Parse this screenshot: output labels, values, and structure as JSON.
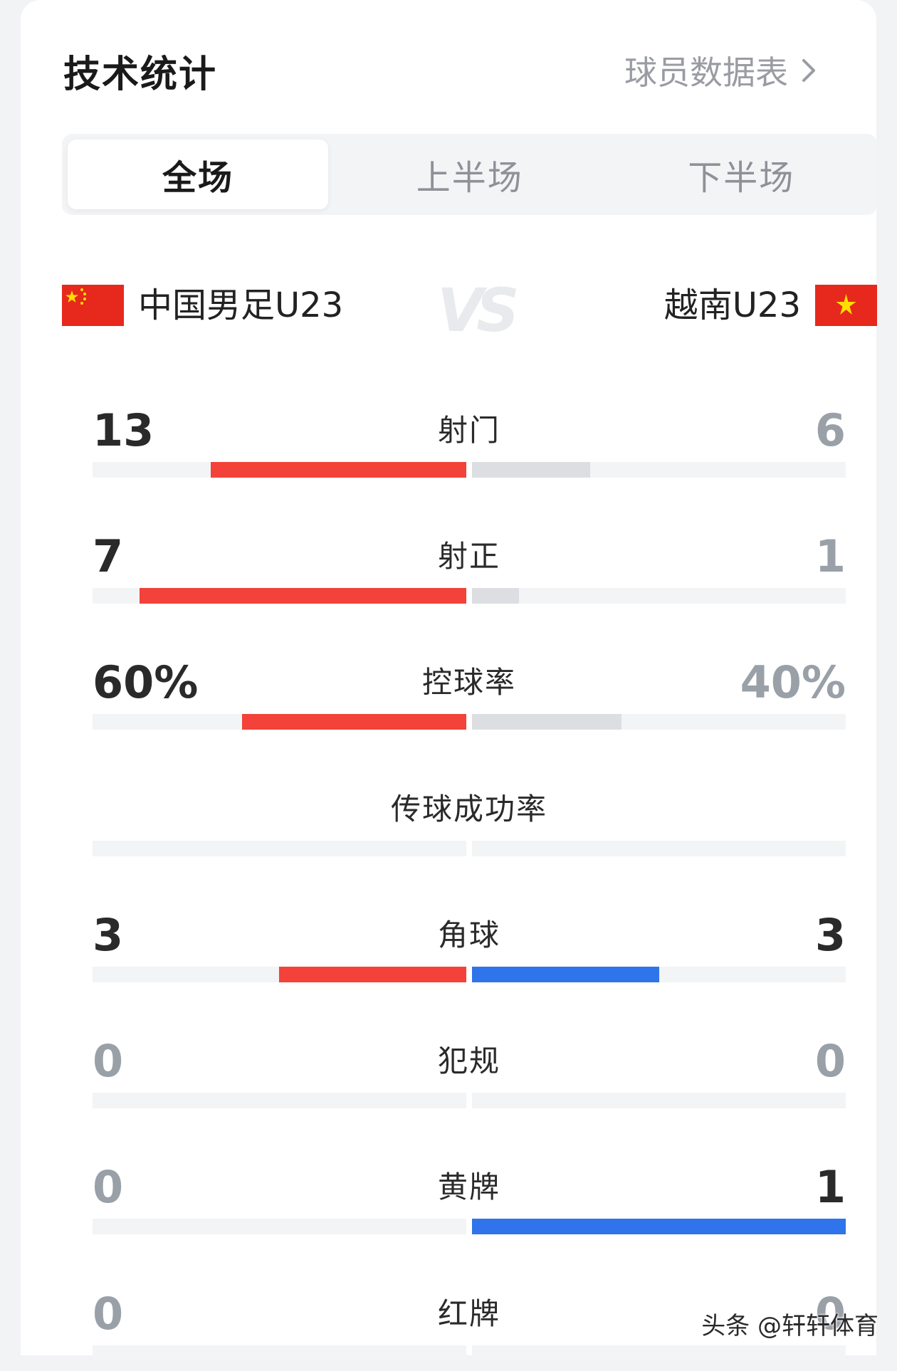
{
  "header": {
    "title": "技术统计",
    "player_link": "球员数据表"
  },
  "tabs": [
    {
      "label": "全场",
      "active": true
    },
    {
      "label": "上半场",
      "active": false
    },
    {
      "label": "下半场",
      "active": false
    }
  ],
  "match": {
    "home": {
      "name": "中国男足U23",
      "flag": "china-flag-icon"
    },
    "away": {
      "name": "越南U23",
      "flag": "vietnam-flag-icon"
    },
    "vs": "VS"
  },
  "stats": [
    {
      "label": "射门",
      "home": "13",
      "away": "6",
      "home_share": 0.684,
      "away_share": 0.316,
      "home_color": "red",
      "away_color": "grey"
    },
    {
      "label": "射正",
      "home": "7",
      "away": "1",
      "home_share": 0.875,
      "away_share": 0.125,
      "home_color": "red",
      "away_color": "grey"
    },
    {
      "label": "控球率",
      "home": "60%",
      "away": "40%",
      "home_share": 0.6,
      "away_share": 0.4,
      "home_color": "red",
      "away_color": "grey"
    },
    {
      "label": "传球成功率",
      "home": "",
      "away": "",
      "home_share": 0,
      "away_share": 0,
      "home_color": "red",
      "away_color": "grey"
    },
    {
      "label": "角球",
      "home": "3",
      "away": "3",
      "home_share": 0.5,
      "away_share": 0.5,
      "home_color": "red",
      "away_color": "blue"
    },
    {
      "label": "犯规",
      "home": "0",
      "away": "0",
      "home_share": 0,
      "away_share": 0,
      "home_color": "red",
      "away_color": "blue"
    },
    {
      "label": "黄牌",
      "home": "0",
      "away": "1",
      "home_share": 0,
      "away_share": 1,
      "home_color": "red",
      "away_color": "blue"
    },
    {
      "label": "红牌",
      "home": "0",
      "away": "0",
      "home_share": 0,
      "away_share": 0,
      "home_color": "red",
      "away_color": "blue"
    }
  ],
  "colors": {
    "home_bar": "#f2423a",
    "away_bar_grey": "#dcdee2",
    "away_bar_blue": "#2f74ea",
    "track": "#f3f4f6"
  },
  "watermark": "头条 @轩轩体育"
}
